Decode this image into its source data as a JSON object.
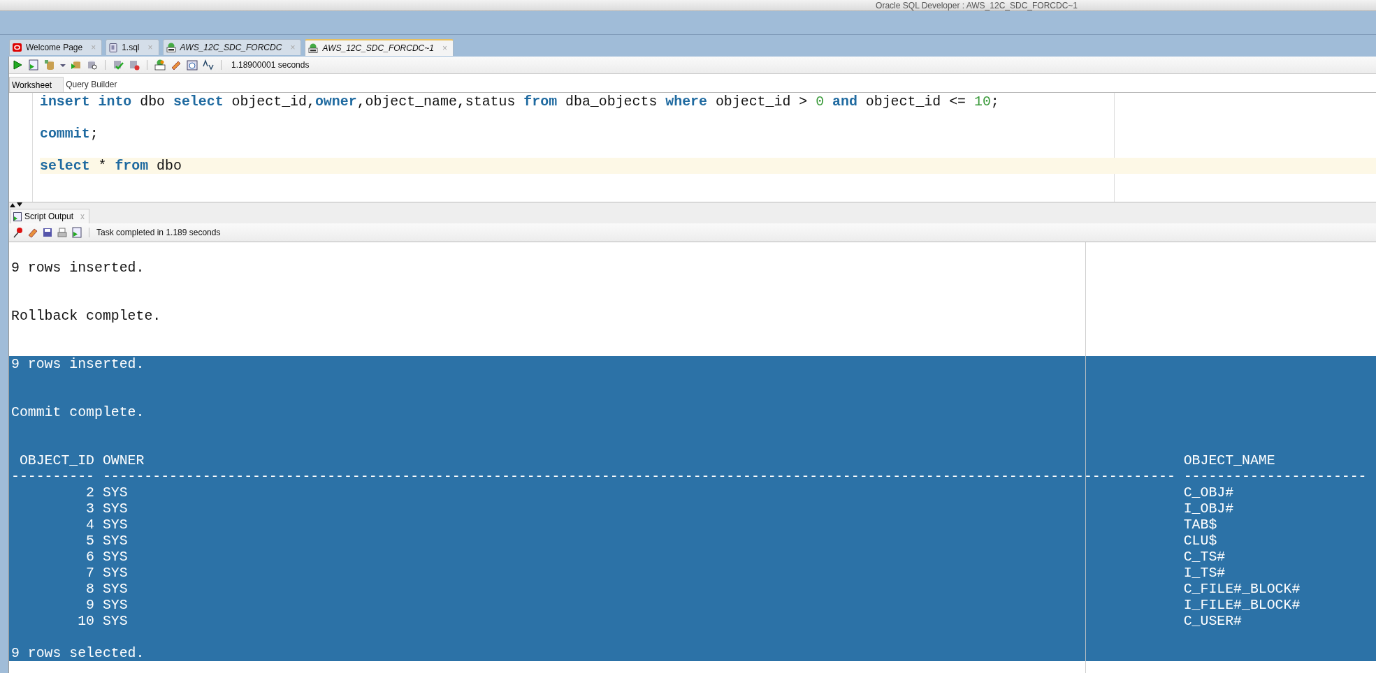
{
  "window": {
    "title": "Oracle SQL Developer : AWS_12C_SDC_FORCDC~1"
  },
  "tabs": [
    {
      "label": "Welcome Page",
      "kind": "welcome",
      "italic": false,
      "selected": false,
      "close": "×"
    },
    {
      "label": "1.sql",
      "kind": "file",
      "italic": false,
      "selected": false,
      "close": "×"
    },
    {
      "label": "AWS_12C_SDC_FORCDC",
      "kind": "connection",
      "italic": true,
      "selected": false,
      "close": "×"
    },
    {
      "label": "AWS_12C_SDC_FORCDC~1",
      "kind": "connection",
      "italic": true,
      "selected": true,
      "close": "×"
    }
  ],
  "toolbar": {
    "elapsed": "1.18900001 seconds"
  },
  "worksheet_tabs": [
    {
      "label": "Worksheet",
      "selected": true
    },
    {
      "label": "Query Builder",
      "selected": false
    }
  ],
  "editor": {
    "lines": [
      {
        "current": false,
        "tokens": [
          {
            "kind": "keyword",
            "text": "insert "
          },
          {
            "kind": "keyword",
            "text": "into"
          },
          {
            "kind": "plain",
            "text": " dbo "
          },
          {
            "kind": "keyword",
            "text": "select"
          },
          {
            "kind": "plain",
            "text": " object_id,"
          },
          {
            "kind": "keyword",
            "text": "owner"
          },
          {
            "kind": "plain",
            "text": ",object_name,status "
          },
          {
            "kind": "keyword",
            "text": "from"
          },
          {
            "kind": "plain",
            "text": " dba_objects "
          },
          {
            "kind": "keyword",
            "text": "where"
          },
          {
            "kind": "plain",
            "text": " object_id > "
          },
          {
            "kind": "number",
            "text": "0 "
          },
          {
            "kind": "keyword",
            "text": "and"
          },
          {
            "kind": "plain",
            "text": " object_id <= "
          },
          {
            "kind": "number",
            "text": "10"
          },
          {
            "kind": "plain",
            "text": ";"
          }
        ]
      },
      {
        "current": false
      },
      {
        "current": false,
        "tokens": [
          {
            "kind": "keyword",
            "text": "commit"
          },
          {
            "kind": "plain",
            "text": ";"
          }
        ]
      },
      {
        "current": false
      },
      {
        "current": true,
        "tokens": [
          {
            "kind": "keyword",
            "text": "select"
          },
          {
            "kind": "plain",
            "text": " * "
          },
          {
            "kind": "keyword",
            "text": "from"
          },
          {
            "kind": "plain",
            "text": " dbo"
          }
        ]
      }
    ]
  },
  "output": {
    "tab": {
      "label": "Script Output",
      "close": "x"
    },
    "status": "Task completed in 1.189 seconds",
    "lines": [
      {
        "kind": "text",
        "text": "9 rows inserted.",
        "selected": false
      },
      {
        "kind": "blank",
        "selected": false
      },
      {
        "kind": "blank",
        "selected": false
      },
      {
        "kind": "text",
        "text": "Rollback complete.",
        "selected": false
      },
      {
        "kind": "blank",
        "selected": false
      },
      {
        "kind": "blank",
        "selected": false
      },
      {
        "kind": "text",
        "text": "9 rows inserted.",
        "selected": true
      },
      {
        "kind": "blank",
        "selected": true
      },
      {
        "kind": "blank",
        "selected": true
      },
      {
        "kind": "text",
        "text": "Commit complete.",
        "selected": true
      },
      {
        "kind": "blank",
        "selected": true
      },
      {
        "kind": "blank",
        "selected": true
      },
      {
        "kind": "header",
        "cells": [
          "OBJECT_ID",
          "OWNER",
          "OBJECT_NAME"
        ],
        "selected": true
      },
      {
        "kind": "separator",
        "cells": [
          "----------",
          "---------------------------------------------------------------------------------------------------------------------------------",
          "----------------------"
        ],
        "selected": true
      },
      {
        "kind": "row",
        "cells": [
          "2",
          "SYS",
          "C_OBJ#"
        ],
        "selected": true
      },
      {
        "kind": "row",
        "cells": [
          "3",
          "SYS",
          "I_OBJ#"
        ],
        "selected": true
      },
      {
        "kind": "row",
        "cells": [
          "4",
          "SYS",
          "TAB$"
        ],
        "selected": true
      },
      {
        "kind": "row",
        "cells": [
          "5",
          "SYS",
          "CLU$"
        ],
        "selected": true
      },
      {
        "kind": "row",
        "cells": [
          "6",
          "SYS",
          "C_TS#"
        ],
        "selected": true
      },
      {
        "kind": "row",
        "cells": [
          "7",
          "SYS",
          "I_TS#"
        ],
        "selected": true
      },
      {
        "kind": "row",
        "cells": [
          "8",
          "SYS",
          "C_FILE#_BLOCK#"
        ],
        "selected": true
      },
      {
        "kind": "row",
        "cells": [
          "9",
          "SYS",
          "I_FILE#_BLOCK#"
        ],
        "selected": true
      },
      {
        "kind": "row",
        "cells": [
          "10",
          "SYS",
          "C_USER#"
        ],
        "selected": true
      },
      {
        "kind": "blank",
        "selected": true
      },
      {
        "kind": "text",
        "text": "9 rows selected.",
        "selected": true
      }
    ]
  }
}
